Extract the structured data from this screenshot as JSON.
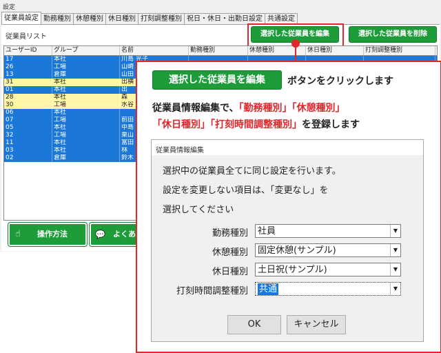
{
  "window": {
    "title": "設定"
  },
  "tabs": [
    "従業員設定",
    "勤務種別",
    "休憩種別",
    "休日種別",
    "打刻調整種別",
    "祝日・休日・出勤日設定",
    "共通設定"
  ],
  "list_label": "従業員リスト",
  "toolbar": {
    "edit_label": "選択した従業員を編集",
    "delete_label": "選択した従業員を削除"
  },
  "table": {
    "columns": [
      "ユーザーID",
      "グループ",
      "名前",
      "勤務種別",
      "休憩種別",
      "休日種別",
      "打刻調整種別"
    ],
    "rows": [
      {
        "id": "17",
        "group": "本社",
        "name": "川島 光子",
        "kind": "blue"
      },
      {
        "id": "26",
        "group": "工場",
        "name": "山崎",
        "kind": "blue"
      },
      {
        "id": "13",
        "group": "倉庫",
        "name": "山田",
        "kind": "blue"
      },
      {
        "id": "31",
        "group": "本社",
        "name": "出横",
        "kind": "yellow"
      },
      {
        "id": "01",
        "group": "本社",
        "name": "出",
        "kind": "blue"
      },
      {
        "id": "28",
        "group": "本社",
        "name": "森",
        "kind": "yellow"
      },
      {
        "id": "30",
        "group": "工場",
        "name": "水谷",
        "kind": "yellow"
      },
      {
        "id": "06",
        "group": "本社",
        "name": "",
        "kind": "blue"
      },
      {
        "id": "07",
        "group": "工場",
        "name": "前田",
        "kind": "blue"
      },
      {
        "id": "05",
        "group": "本社",
        "name": "中島",
        "kind": "blue"
      },
      {
        "id": "32",
        "group": "工場",
        "name": "栗山",
        "kind": "blue"
      },
      {
        "id": "11",
        "group": "本社",
        "name": "富田",
        "kind": "blue"
      },
      {
        "id": "03",
        "group": "本社",
        "name": "林",
        "kind": "blue"
      },
      {
        "id": "02",
        "group": "倉庫",
        "name": "鈴木",
        "kind": "blue"
      }
    ]
  },
  "bottom": {
    "howto_label": "操作方法",
    "faq_label": "よくあ"
  },
  "callout": {
    "button_label": "選択した従業員を編集",
    "line1_suffix": "ボタンをクリックします",
    "line2_prefix": "従業員情報編集で、",
    "term_work": "「勤務種別」",
    "term_break": "「休憩種別」",
    "term_holiday": "「休日種別」",
    "term_stamp": "「打刻時間調整種別」",
    "line3_suffix": "を登録します"
  },
  "dialog": {
    "title": "従業員情報編集",
    "desc1": "選択中の従業員全てに同じ設定を行います。",
    "desc2": "設定を変更しない項目は、「変更なし」を",
    "desc3": "選択してください",
    "fields": [
      {
        "label": "勤務種別",
        "value": "社員"
      },
      {
        "label": "休憩種別",
        "value": "固定休憩(サンプル)"
      },
      {
        "label": "休日種別",
        "value": "土日祝(サンプル)"
      },
      {
        "label": "打刻時間調整種別",
        "value": "共通"
      }
    ],
    "ok_label": "OK",
    "cancel_label": "キャンセル"
  },
  "colors": {
    "accent_green": "#1e9c3a",
    "highlight_red": "#e2262b",
    "selection_blue": "#1c78d8",
    "row_yellow": "#fff7a8"
  }
}
